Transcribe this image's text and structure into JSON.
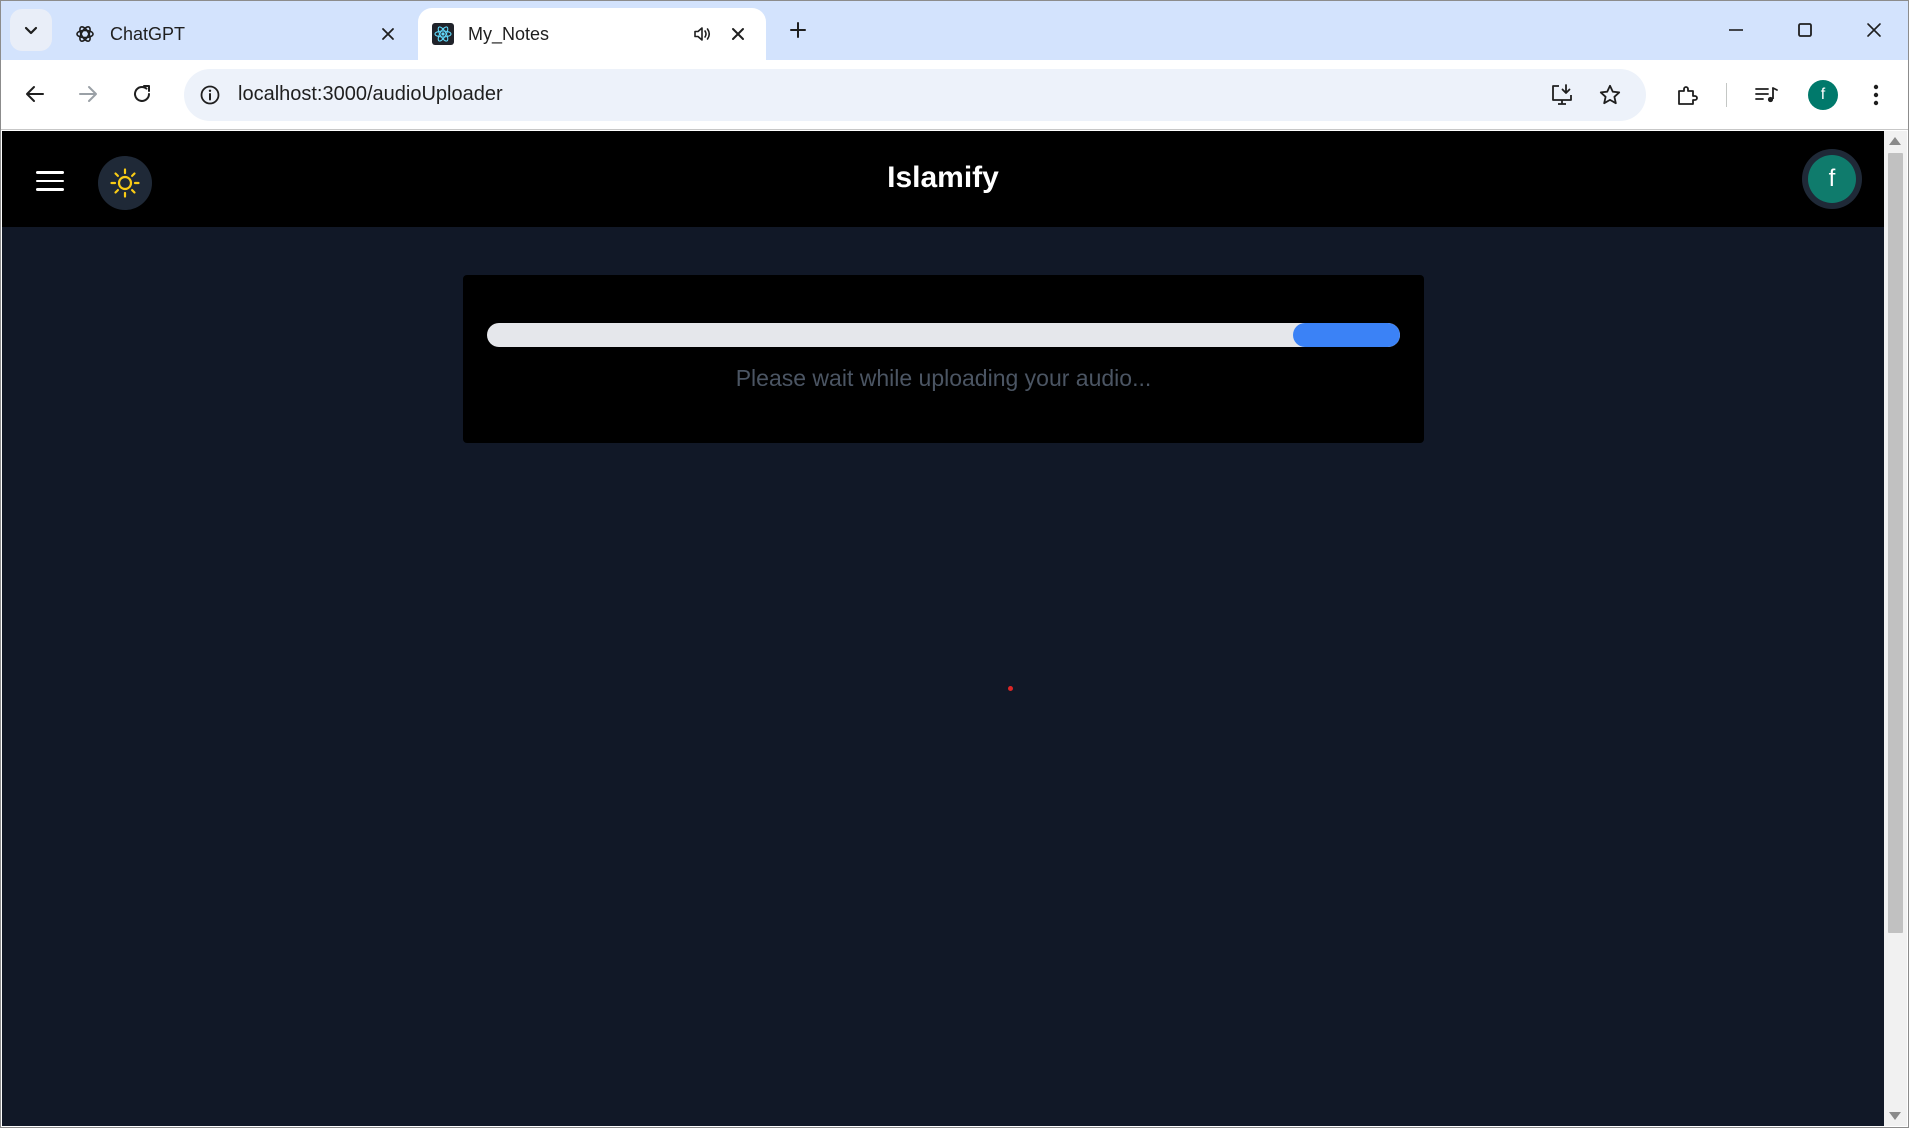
{
  "browser": {
    "tabs": [
      {
        "title": "ChatGPT",
        "favicon": "chatgpt-logo-icon",
        "active": false
      },
      {
        "title": "My_Notes",
        "favicon": "react-logo-icon",
        "active": true,
        "audio": "speaker-icon"
      }
    ],
    "new_tab_icon": "plus-icon",
    "address_bar": {
      "url": "localhost:3000/audioUploader",
      "info_icon": "info-icon"
    },
    "window_controls": [
      "minimize-icon",
      "maximize-icon",
      "close-icon"
    ],
    "profile_initial": "f",
    "profile_color": "#00796b"
  },
  "app": {
    "brand": "Islamify",
    "menu_icon": "hamburger-menu-icon",
    "theme_icon": "sun-icon",
    "theme_icon_color": "#facc15",
    "user_initial": "f",
    "user_avatar_color": "#0f7b6c"
  },
  "upload": {
    "message": "Please wait while uploading your audio...",
    "progress_fill_start": 0.883,
    "progress_fill_end": 1.0,
    "progress_color": "#3b82f6"
  },
  "colors": {
    "page_background": "#111827",
    "header_background": "#000000",
    "card_background": "#000000"
  }
}
